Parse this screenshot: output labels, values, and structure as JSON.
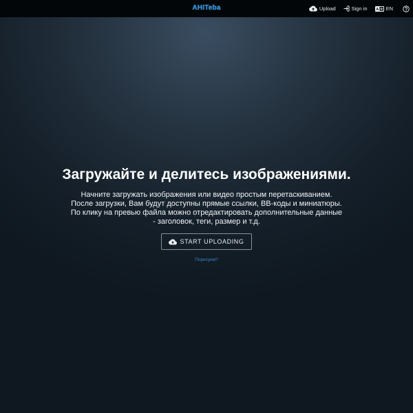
{
  "header": {
    "logo_text": "AHITeba",
    "nav": {
      "upload_label": "Upload",
      "signin_label": "Sign in",
      "language_label": "EN"
    }
  },
  "hero": {
    "title": "Загружайте и делитесь изображениями.",
    "description_lines": [
      "Начните загружать изображения или видео простым перетаскиванием.",
      "После загрузки, Вам будут доступны прямые ссылки, BB-коды и миниатюры.",
      "По клику на превью файла можно отредактировать дополнительные данные",
      "- заголовок, теги, размер и т.д."
    ],
    "button_label": "START UPLOADING",
    "helper_link": "Порисуем?"
  },
  "colors": {
    "accent": "#2d8ed1",
    "link": "#3a84c4",
    "topbar": "#030608"
  },
  "icons": {
    "upload": "cloud-upload-icon",
    "signin": "sign-in-icon",
    "language": "language-icon",
    "help": "help-icon"
  }
}
